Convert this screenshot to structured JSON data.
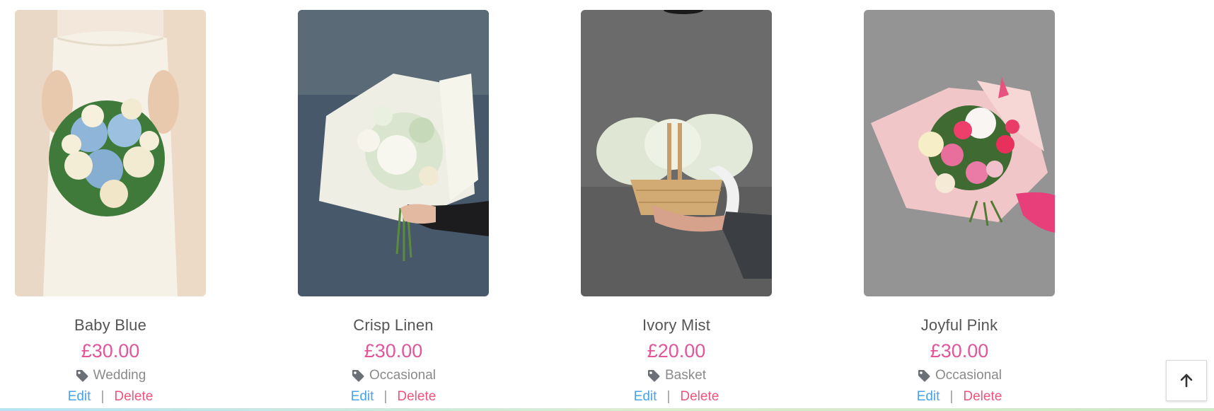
{
  "products": [
    {
      "name": "Baby Blue",
      "price": "£30.00",
      "category": "Wedding",
      "edit_label": "Edit",
      "separator": "|",
      "delete_label": "Delete",
      "image_icon": "bouquet-photo-baby-blue"
    },
    {
      "name": "Crisp Linen",
      "price": "£30.00",
      "category": "Occasional",
      "edit_label": "Edit",
      "separator": "|",
      "delete_label": "Delete",
      "image_icon": "bouquet-photo-crisp-linen"
    },
    {
      "name": "Ivory Mist",
      "price": "£20.00",
      "category": "Basket",
      "edit_label": "Edit",
      "separator": "|",
      "delete_label": "Delete",
      "image_icon": "bouquet-photo-ivory-mist"
    },
    {
      "name": "Joyful Pink",
      "price": "£30.00",
      "category": "Occasional",
      "edit_label": "Edit",
      "separator": "|",
      "delete_label": "Delete",
      "image_icon": "bouquet-photo-joyful-pink"
    }
  ],
  "scroll_to_top": {
    "icon": "arrow-up-icon"
  },
  "colors": {
    "price": "#e0569a",
    "edit": "#4aa3e8",
    "delete": "#f0547a",
    "name": "#555555",
    "category": "#8a8a8a"
  }
}
